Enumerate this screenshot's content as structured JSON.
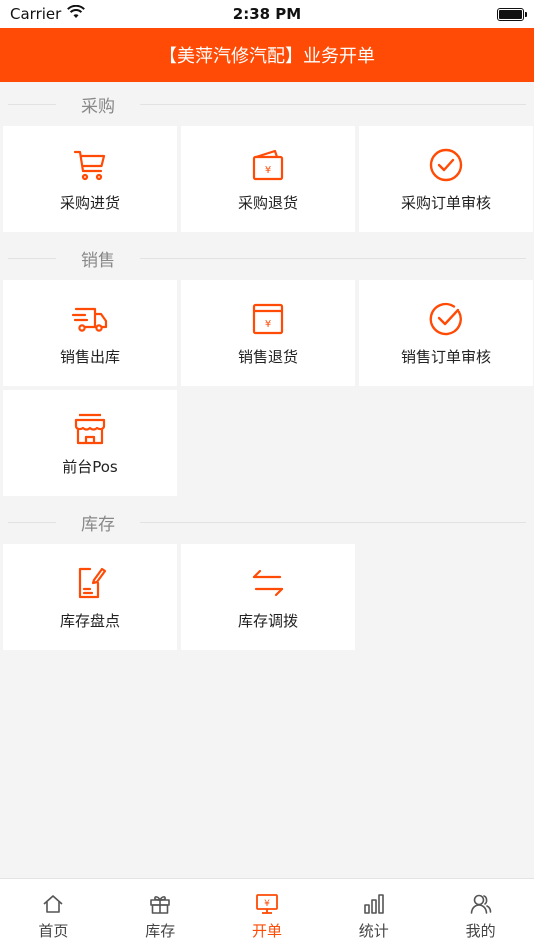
{
  "status_bar": {
    "carrier": "Carrier",
    "time": "2:38 PM"
  },
  "header": {
    "title": "【美萍汽修汽配】业务开单"
  },
  "sections": [
    {
      "title": "采购",
      "items": [
        {
          "label": "采购进货",
          "icon": "cart-icon"
        },
        {
          "label": "采购退货",
          "icon": "wallet-icon"
        },
        {
          "label": "采购订单审核",
          "icon": "check-circle-icon"
        }
      ]
    },
    {
      "title": "销售",
      "items": [
        {
          "label": "销售出库",
          "icon": "truck-icon"
        },
        {
          "label": "销售退货",
          "icon": "return-box-icon"
        },
        {
          "label": "销售订单审核",
          "icon": "check-circle-open-icon"
        },
        {
          "label": "前台Pos",
          "icon": "store-icon"
        }
      ]
    },
    {
      "title": "库存",
      "items": [
        {
          "label": "库存盘点",
          "icon": "edit-doc-icon"
        },
        {
          "label": "库存调拨",
          "icon": "transfer-icon"
        }
      ]
    }
  ],
  "tabbar": {
    "tabs": [
      {
        "label": "首页",
        "icon": "home-icon",
        "active": false
      },
      {
        "label": "库存",
        "icon": "gift-icon",
        "active": false
      },
      {
        "label": "开单",
        "icon": "screen-icon",
        "active": true
      },
      {
        "label": "统计",
        "icon": "bar-chart-icon",
        "active": false
      },
      {
        "label": "我的",
        "icon": "user-icon",
        "active": false
      }
    ]
  },
  "colors": {
    "accent": "#ff4b05",
    "background": "#f4f4f4"
  }
}
